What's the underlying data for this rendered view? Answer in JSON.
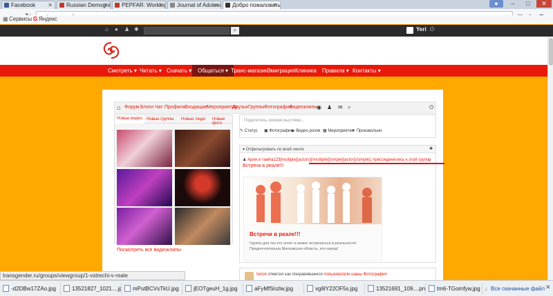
{
  "browser": {
    "tabs": [
      {
        "label": "Facebook",
        "color": "#3b5998"
      },
      {
        "label": "Russian Demograph",
        "color": "#c0392b"
      },
      {
        "label": "PEPFAR: Working To",
        "color": "#c0392b"
      },
      {
        "label": "Journal of Adolesce",
        "color": "#888888"
      },
      {
        "label": "Добро пожаловать",
        "color": "#333333"
      }
    ],
    "url": "transgender.ru",
    "bookmarks": [
      "Сервисы",
      "Яндекс"
    ]
  },
  "site": {
    "user_name": "Yeri",
    "nav": [
      "Смотреть ▾",
      "Читать ▾",
      "Скачать ▾",
      "Общаться ▾",
      "Транс-магазин",
      "Эмиграция",
      "Клиника",
      "Правила ▾",
      "Контакты ▾"
    ],
    "subnav": [
      "Форум",
      "Блоги",
      "Чат",
      "Профиль",
      "Входящие",
      "Мероприятия",
      "Друзья",
      "Группы",
      "Фотографии",
      "Видеоклипы"
    ],
    "media_tabs": [
      "Новые видео",
      "Новые группы",
      "Новые люди",
      "Новые фото"
    ],
    "view_all": "Посмотреть все видеоклипы",
    "status_placeholder": "Поделитесь своими мыслями...",
    "post_actions": [
      "Статус",
      "Фотография",
      "Видео ролик",
      "Мероприятие",
      "Произвольно"
    ],
    "filter_label": "Отфильтровать по всей ленте",
    "activity_line": "Ария и тамhа123[multiple]{actors}[/multiple][simple]{actor}[/simple], присоединились к этой группе",
    "group_link": "Встречи в реале!!!",
    "group_title": "Встречи в реале!!!",
    "group_desc": "Группа для тех кто хочет и может встречаться в реальности!Предпочтительна Московская область, кто напед!",
    "second_activity": "отметил как понравившееся",
    "second_user": "Ionon",
    "second_link": "пользователи шаны Фотография"
  },
  "statusbar": "transgender.ru/groups/viewgroup/1-vstrechi-v-reale",
  "downloads": [
    "-d2DBw17ZAo.jpg",
    "13521827_1021....jpg",
    "mPutBCVsTkU.jpg",
    "jEOTgeuH_1g.jpg",
    "aFyMfSnzlw.jpg",
    "vg6lY22OF5s.jpg",
    "13521691_109....png",
    "tm6-TGomfyw.jpg"
  ],
  "downloads_all": "Все скачанные файлы...",
  "colors": {
    "accent": "#e8190a",
    "background": "#ffa800",
    "dark": "#2b2b2b"
  }
}
